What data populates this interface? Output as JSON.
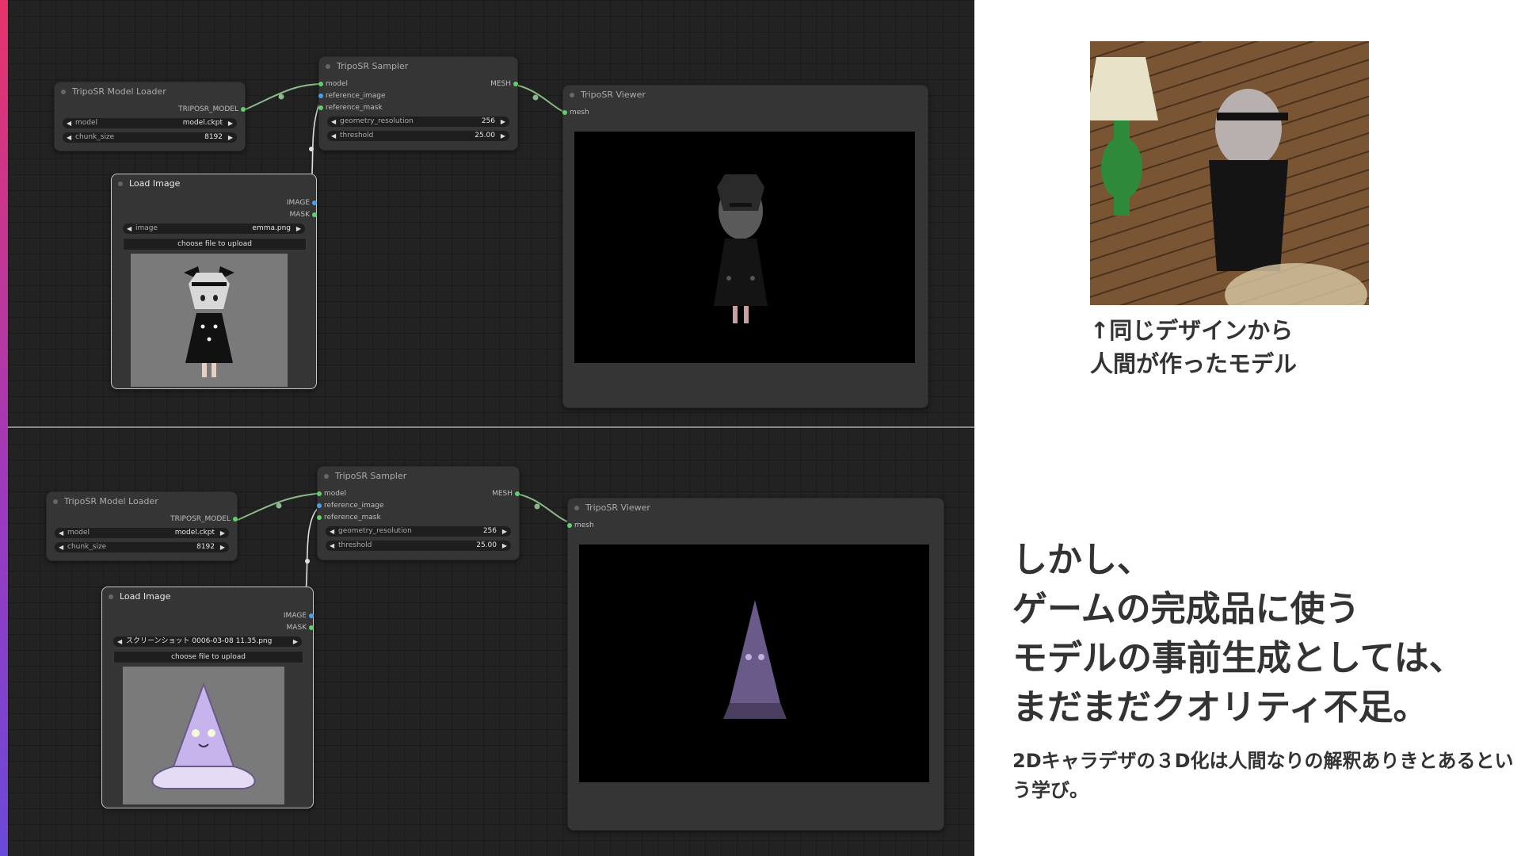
{
  "top_graph": {
    "model_loader": {
      "title": "TripoSR Model Loader",
      "output": "TRIPOSR_MODEL",
      "widgets": [
        {
          "label": "model",
          "value": "model.ckpt"
        },
        {
          "label": "chunk_size",
          "value": "8192"
        }
      ]
    },
    "sampler": {
      "title": "TripoSR Sampler",
      "inputs": [
        "model",
        "reference_image",
        "reference_mask"
      ],
      "output": "MESH",
      "widgets": [
        {
          "label": "geometry_resolution",
          "value": "256"
        },
        {
          "label": "threshold",
          "value": "25.00"
        }
      ]
    },
    "viewer": {
      "title": "TripoSR Viewer",
      "input": "mesh"
    },
    "load_image": {
      "title": "Load Image",
      "outputs": [
        "IMAGE",
        "MASK"
      ],
      "widget": {
        "label": "image",
        "value": "emma.png"
      },
      "upload_label": "choose file to upload"
    }
  },
  "bottom_graph": {
    "model_loader": {
      "title": "TripoSR Model Loader",
      "output": "TRIPOSR_MODEL",
      "widgets": [
        {
          "label": "model",
          "value": "model.ckpt"
        },
        {
          "label": "chunk_size",
          "value": "8192"
        }
      ]
    },
    "sampler": {
      "title": "TripoSR Sampler",
      "inputs": [
        "model",
        "reference_image",
        "reference_mask"
      ],
      "output": "MESH",
      "widgets": [
        {
          "label": "geometry_resolution",
          "value": "256"
        },
        {
          "label": "threshold",
          "value": "25.00"
        }
      ]
    },
    "viewer": {
      "title": "TripoSR Viewer",
      "input": "mesh"
    },
    "load_image": {
      "title": "Load Image",
      "outputs": [
        "IMAGE",
        "MASK"
      ],
      "widget": {
        "label": "image",
        "value": "スクリーンショット 0006-03-08 11.35.png"
      },
      "upload_label": "choose file to upload"
    }
  },
  "slide": {
    "ref_caption_line1": "↑同じデザインから",
    "ref_caption_line2": "人間が作ったモデル",
    "heading_lines": [
      "しかし、",
      "ゲームの完成品に使う",
      "モデルの事前生成としては、",
      "まだまだクオリティ不足。"
    ],
    "note": "2Dキャラデザの３D化は人間なりの解釈ありきとあるという学び。"
  },
  "colors": {
    "canvas_bg": "#222222",
    "node_bg": "#353535",
    "slot_green": "#5fd06a",
    "slot_blue": "#4aa0e8",
    "accent_top": "#e8336a",
    "accent_bottom": "#6a4ad8"
  }
}
